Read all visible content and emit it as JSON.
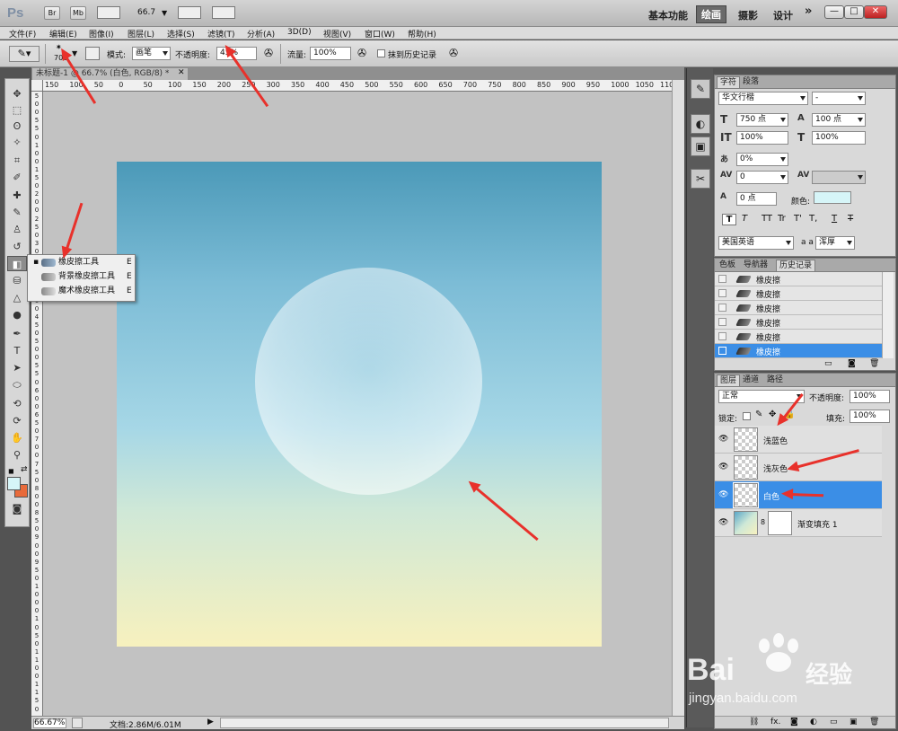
{
  "appbar": {
    "logo": "Ps",
    "buttons": [
      "Br",
      "Mb"
    ],
    "zoom": "66.7",
    "workspaces": [
      "基本功能",
      "绘画",
      "摄影",
      "设计"
    ],
    "active_workspace": "绘画",
    "more": "»",
    "win": [
      "—",
      "□",
      "✕"
    ]
  },
  "menu": [
    "文件(F)",
    "编辑(E)",
    "图像(I)",
    "图层(L)",
    "选择(S)",
    "滤镜(T)",
    "分析(A)",
    "3D(D)",
    "视图(V)",
    "窗口(W)",
    "帮助(H)"
  ],
  "options": {
    "brush_size": "700",
    "mode_label": "模式:",
    "mode_value": "画笔",
    "opacity_label": "不透明度:",
    "opacity_value": "45%",
    "flow_label": "流量:",
    "flow_value": "100%",
    "history_label": "抹到历史记录"
  },
  "document": {
    "tab_title": "未标题-1 @ 66.7% (白色, RGB/8) *",
    "ruler_h": [
      "150",
      "100",
      "50",
      "0",
      "50",
      "100",
      "150",
      "200",
      "250",
      "300",
      "350",
      "400",
      "450",
      "500",
      "550",
      "600",
      "650",
      "700",
      "750",
      "800",
      "850",
      "900",
      "950",
      "1000",
      "1050",
      "1100"
    ],
    "ruler_v": [
      "5",
      "0",
      "0",
      "5",
      "5",
      "0",
      "1",
      "0",
      "0",
      "1",
      "5",
      "0",
      "2",
      "0",
      "0",
      "2",
      "5",
      "0",
      "3",
      "0",
      "0",
      "3",
      "5",
      "0",
      "4",
      "0",
      "0",
      "4",
      "5",
      "0",
      "5",
      "0",
      "0",
      "5",
      "5",
      "0",
      "6",
      "0",
      "0",
      "6",
      "5",
      "0",
      "7",
      "0",
      "0",
      "7",
      "5",
      "0",
      "8",
      "0",
      "0",
      "8",
      "5",
      "0",
      "9",
      "0",
      "0",
      "9",
      "5",
      "0",
      "1",
      "0",
      "0",
      "0",
      "1",
      "0",
      "5",
      "0",
      "1",
      "1",
      "0",
      "0",
      "1",
      "1",
      "5",
      "0"
    ],
    "status_zoom": "66.67%",
    "status_doc": "文档:2.86M/6.01M"
  },
  "flyout": {
    "items": [
      {
        "label": "橡皮擦工具",
        "key": "E"
      },
      {
        "label": "背景橡皮擦工具",
        "key": "E"
      },
      {
        "label": "魔术橡皮擦工具",
        "key": "E"
      }
    ]
  },
  "character": {
    "tabs": [
      "字符",
      "段落"
    ],
    "font_family": "华文行楷",
    "font_style": "-",
    "size": "750 点",
    "leading": "100 点",
    "vscale": "100%",
    "hscale": "100%",
    "tsume": "0%",
    "kerning": "0",
    "baseline": "0 点",
    "color_label": "颜色:",
    "language": "美国英语",
    "aa_label": "a a",
    "antialias": "浑厚",
    "style_buttons": [
      "T",
      "T",
      "TT",
      "Tr",
      "T'",
      "T,",
      "T",
      "T"
    ]
  },
  "history": {
    "tabs": [
      "色板",
      "导航器",
      "历史记录"
    ],
    "items": [
      "橡皮擦",
      "橡皮擦",
      "橡皮擦",
      "橡皮擦",
      "橡皮擦",
      "橡皮擦"
    ]
  },
  "layers": {
    "tabs": [
      "图层",
      "通道",
      "路径"
    ],
    "blend": "正常",
    "opacity_label": "不透明度:",
    "opacity": "100%",
    "lock_label": "锁定:",
    "fill_label": "填充:",
    "fill": "100%",
    "items": [
      {
        "name": "浅蓝色"
      },
      {
        "name": "浅灰色"
      },
      {
        "name": "白色"
      },
      {
        "name": "渐变填充 1"
      }
    ],
    "footer": "fx."
  },
  "watermark": {
    "brand": "Bai",
    "brand2": "经验",
    "url": "jingyan.baidu.com"
  },
  "colors": {
    "selection": "#3b8ee6",
    "arrow": "#e8312b",
    "fg_swatch": "#d6f5f8",
    "bg_swatch": "#e86a3a"
  }
}
